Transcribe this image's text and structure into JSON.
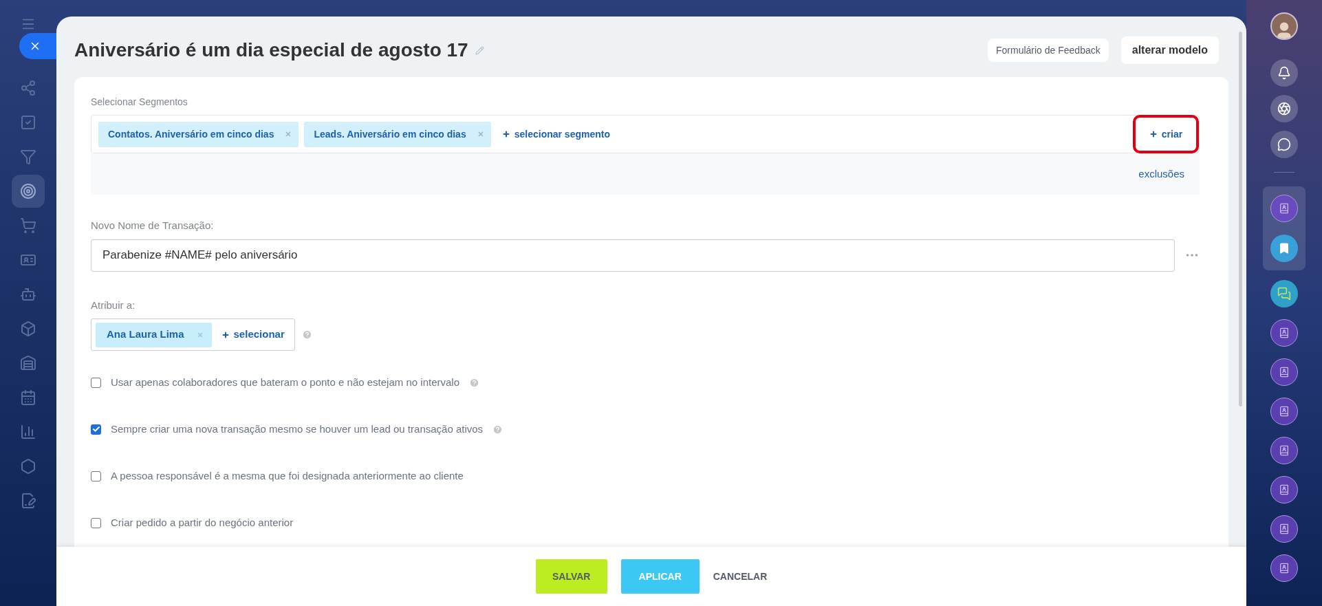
{
  "left_nav": {
    "items": [
      {
        "selected": false
      },
      {
        "selected": false
      },
      {
        "selected": false
      },
      {
        "selected": true
      },
      {
        "selected": false
      },
      {
        "selected": false
      },
      {
        "selected": false
      },
      {
        "selected": false
      },
      {
        "selected": false
      },
      {
        "selected": false
      },
      {
        "selected": false
      },
      {
        "selected": false
      },
      {
        "selected": false
      }
    ]
  },
  "header": {
    "title": "Aniversário é um dia especial de agosto 17",
    "buttons": [
      "Formulário de Feedback",
      "alterar modelo"
    ]
  },
  "segments": {
    "label": "Selecionar Segmentos",
    "tags": [
      "Contatos. Aniversário em cinco dias",
      "Leads. Aniversário em cinco dias"
    ],
    "select_link": "selecionar segmento",
    "create_link": "criar",
    "exclusions_link": "exclusões"
  },
  "transaction_name": {
    "label": "Novo Nome de Transação:",
    "value": "Parabenize #NAME# pelo aniversário"
  },
  "assign": {
    "label": "Atribuir a:",
    "tags": [
      "Ana Laura Lima"
    ],
    "select_link": "selecionar"
  },
  "options": [
    {
      "label": "Usar apenas colaboradores que bateram o ponto e não estejam no intervalo",
      "checked": false,
      "help": true
    },
    {
      "label": "Sempre criar uma nova transação mesmo se houver um lead ou transação ativos",
      "checked": true,
      "help": true
    },
    {
      "label": "A pessoa responsável é a mesma que foi designada anteriormente ao cliente",
      "checked": false,
      "help": false
    },
    {
      "label": "Criar pedido a partir do negócio anterior",
      "checked": false,
      "help": false
    }
  ],
  "footer": {
    "buttons": [
      {
        "label": "SALVAR",
        "kind": "primary"
      },
      {
        "label": "APLICAR",
        "kind": "secondary"
      },
      {
        "label": "CANCELAR",
        "kind": "link"
      }
    ]
  }
}
